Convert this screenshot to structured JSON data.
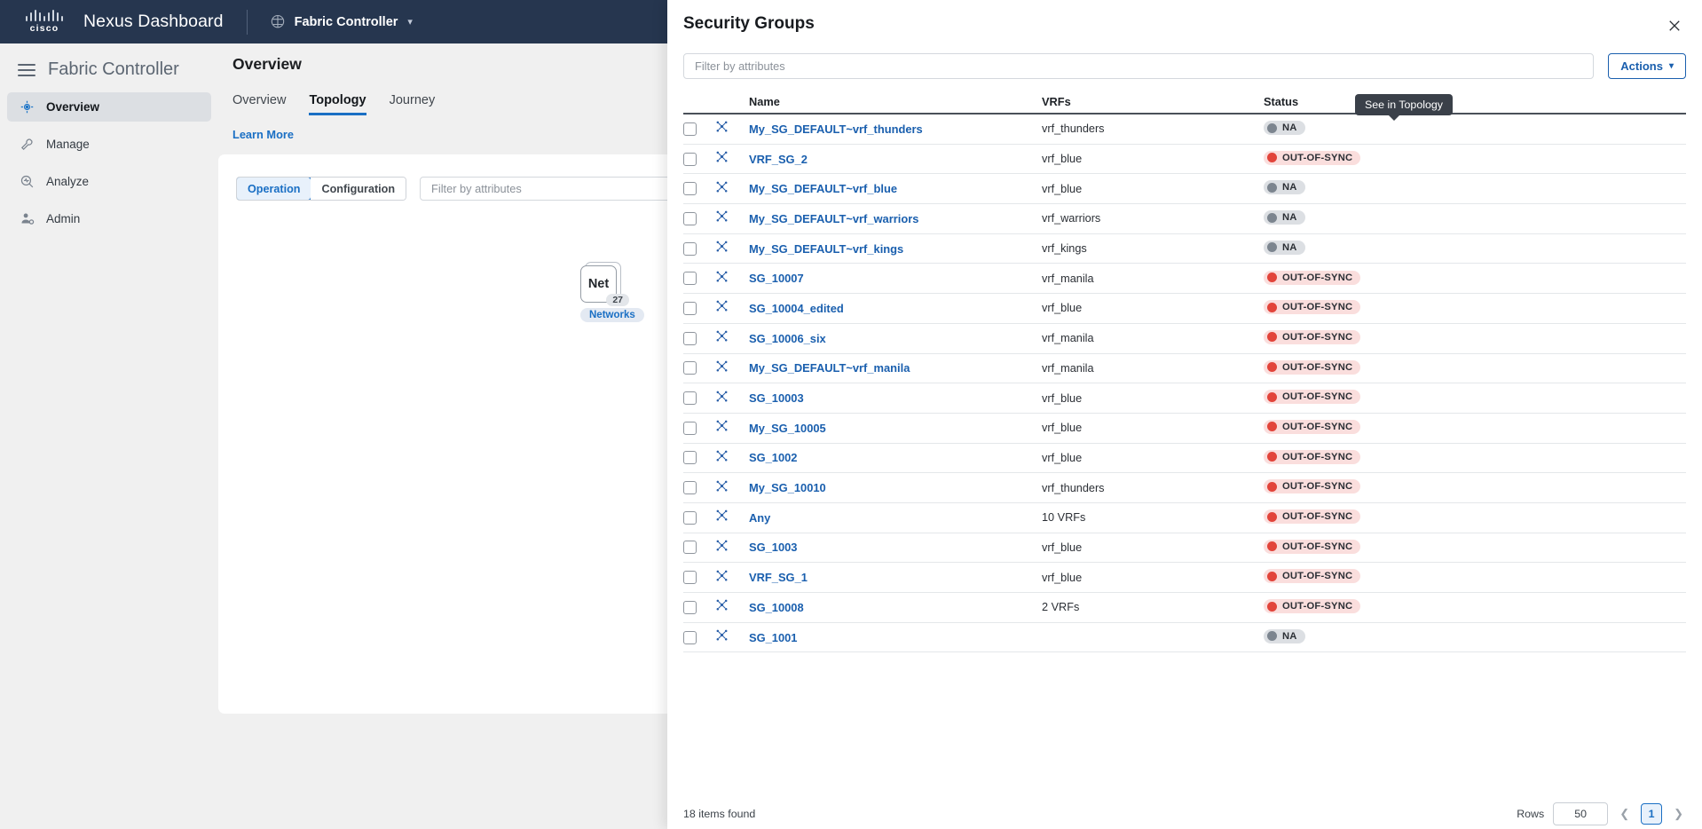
{
  "topbar": {
    "brand": "cisco",
    "product": "Nexus Dashboard",
    "service": "Fabric Controller",
    "service_caret": "chevron-down"
  },
  "sidebar": {
    "title": "Fabric Controller",
    "items": [
      {
        "label": "Overview",
        "icon": "overview-icon",
        "active": true
      },
      {
        "label": "Manage",
        "icon": "wrench-icon",
        "active": false
      },
      {
        "label": "Analyze",
        "icon": "magnifier-pulse-icon",
        "active": false
      },
      {
        "label": "Admin",
        "icon": "user-gear-icon",
        "active": false
      }
    ]
  },
  "main": {
    "page_title": "Overview",
    "tabs": [
      {
        "label": "Overview",
        "active": false
      },
      {
        "label": "Topology",
        "active": true
      },
      {
        "label": "Journey",
        "active": false
      }
    ],
    "learn_more": "Learn More",
    "toolbar": {
      "segment": [
        {
          "label": "Operation",
          "active": true
        },
        {
          "label": "Configuration",
          "active": false
        }
      ],
      "filter_placeholder": "Filter by attributes"
    },
    "topology": {
      "node_label": "Net",
      "node_count": "27",
      "node_caption": "Networks"
    }
  },
  "drawer": {
    "title": "Security Groups",
    "close_icon": "close-icon",
    "filter_placeholder": "Filter by attributes",
    "actions_label": "Actions",
    "tooltip": "See in Topology",
    "columns": {
      "name": "Name",
      "vrfs": "VRFs",
      "status": "Status"
    },
    "rows": [
      {
        "name": "My_SG_DEFAULT~vrf_thunders",
        "vrfs": "vrf_thunders",
        "status": "NA",
        "status_kind": "na"
      },
      {
        "name": "VRF_SG_2",
        "vrfs": "vrf_blue",
        "status": "OUT-OF-SYNC",
        "status_kind": "oos"
      },
      {
        "name": "My_SG_DEFAULT~vrf_blue",
        "vrfs": "vrf_blue",
        "status": "NA",
        "status_kind": "na"
      },
      {
        "name": "My_SG_DEFAULT~vrf_warriors",
        "vrfs": "vrf_warriors",
        "status": "NA",
        "status_kind": "na"
      },
      {
        "name": "My_SG_DEFAULT~vrf_kings",
        "vrfs": "vrf_kings",
        "status": "NA",
        "status_kind": "na"
      },
      {
        "name": "SG_10007",
        "vrfs": "vrf_manila",
        "status": "OUT-OF-SYNC",
        "status_kind": "oos"
      },
      {
        "name": "SG_10004_edited",
        "vrfs": "vrf_blue",
        "status": "OUT-OF-SYNC",
        "status_kind": "oos"
      },
      {
        "name": "SG_10006_six",
        "vrfs": "vrf_manila",
        "status": "OUT-OF-SYNC",
        "status_kind": "oos"
      },
      {
        "name": "My_SG_DEFAULT~vrf_manila",
        "vrfs": "vrf_manila",
        "status": "OUT-OF-SYNC",
        "status_kind": "oos"
      },
      {
        "name": "SG_10003",
        "vrfs": "vrf_blue",
        "status": "OUT-OF-SYNC",
        "status_kind": "oos"
      },
      {
        "name": "My_SG_10005",
        "vrfs": "vrf_blue",
        "status": "OUT-OF-SYNC",
        "status_kind": "oos"
      },
      {
        "name": "SG_1002",
        "vrfs": "vrf_blue",
        "status": "OUT-OF-SYNC",
        "status_kind": "oos"
      },
      {
        "name": "My_SG_10010",
        "vrfs": "vrf_thunders",
        "status": "OUT-OF-SYNC",
        "status_kind": "oos"
      },
      {
        "name": "Any",
        "vrfs": "10 VRFs",
        "status": "OUT-OF-SYNC",
        "status_kind": "oos"
      },
      {
        "name": "SG_1003",
        "vrfs": "vrf_blue",
        "status": "OUT-OF-SYNC",
        "status_kind": "oos"
      },
      {
        "name": "VRF_SG_1",
        "vrfs": "vrf_blue",
        "status": "OUT-OF-SYNC",
        "status_kind": "oos"
      },
      {
        "name": "SG_10008",
        "vrfs": "2 VRFs",
        "status": "OUT-OF-SYNC",
        "status_kind": "oos"
      },
      {
        "name": "SG_1001",
        "vrfs": "",
        "status": "NA",
        "status_kind": "na"
      }
    ],
    "footer": {
      "count": "18 items found",
      "rows_label": "Rows",
      "rows_per_page": "50",
      "page": "1",
      "prev_icon": "chevron-left-icon",
      "next_icon": "chevron-right-icon"
    }
  },
  "colors": {
    "topbar_bg": "#26364f",
    "accent_blue": "#1a6fc4",
    "link_blue": "#1a5fae",
    "status_na": "#7c858f",
    "status_oos": "#e2443a",
    "tooltip_bg": "#3a4049"
  }
}
